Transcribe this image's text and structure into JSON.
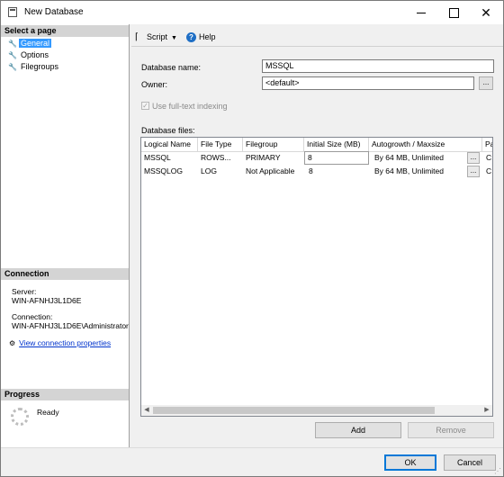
{
  "window": {
    "title": "New Database"
  },
  "left_pane": {
    "select_page_header": "Select a page",
    "pages": [
      {
        "label": "General",
        "selected": true
      },
      {
        "label": "Options",
        "selected": false
      },
      {
        "label": "Filegroups",
        "selected": false
      }
    ],
    "connection_header": "Connection",
    "server_label": "Server:",
    "server_value": "WIN-AFNHJ3L1D6E",
    "connection_label": "Connection:",
    "connection_value": "WIN-AFNHJ3L1D6E\\Administrator",
    "view_connection_link": "View connection properties",
    "progress_header": "Progress",
    "progress_status": "Ready"
  },
  "toolbar": {
    "script_label": "Script",
    "help_label": "Help"
  },
  "form": {
    "db_name_label": "Database name:",
    "db_name_value": "MSSQL",
    "owner_label": "Owner:",
    "owner_value": "<default>",
    "fulltext_label": "Use full-text indexing",
    "fulltext_checked": true,
    "files_label": "Database files:"
  },
  "files_table": {
    "columns": [
      "Logical Name",
      "File Type",
      "Filegroup",
      "Initial Size (MB)",
      "Autogrowth / Maxsize",
      "Pa"
    ],
    "rows": [
      {
        "logical_name": "MSSQL",
        "file_type": "ROWS...",
        "filegroup": "PRIMARY",
        "initial_size": "8",
        "autogrowth": "By 64 MB, Unlimited",
        "path": "C:\\"
      },
      {
        "logical_name": "MSSQLOG",
        "file_type": "LOG",
        "filegroup": "Not Applicable",
        "initial_size": "8",
        "autogrowth": "By 64 MB, Unlimited",
        "path": "C:\\"
      }
    ]
  },
  "buttons": {
    "ellipsis": "...",
    "add": "Add",
    "remove": "Remove",
    "ok": "OK",
    "cancel": "Cancel"
  }
}
